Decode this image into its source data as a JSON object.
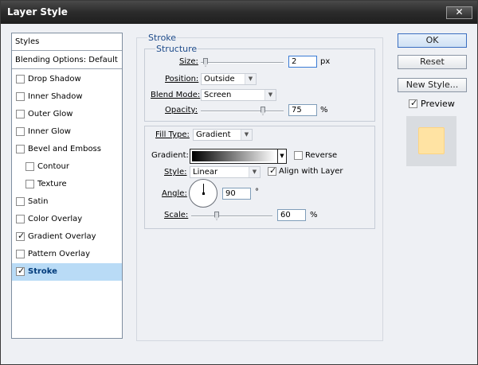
{
  "window": {
    "title": "Layer Style",
    "close_glyph": "✕"
  },
  "styles_list": {
    "header": "Styles",
    "blending": "Blending Options: Default",
    "items": [
      {
        "label": "Drop Shadow",
        "checked": false
      },
      {
        "label": "Inner Shadow",
        "checked": false
      },
      {
        "label": "Outer Glow",
        "checked": false
      },
      {
        "label": "Inner Glow",
        "checked": false
      },
      {
        "label": "Bevel and Emboss",
        "checked": false
      },
      {
        "label": "Contour",
        "checked": false
      },
      {
        "label": "Texture",
        "checked": false
      },
      {
        "label": "Satin",
        "checked": false
      },
      {
        "label": "Color Overlay",
        "checked": false
      },
      {
        "label": "Gradient Overlay",
        "checked": true
      },
      {
        "label": "Pattern Overlay",
        "checked": false
      },
      {
        "label": "Stroke",
        "checked": true,
        "selected": true
      }
    ]
  },
  "stroke": {
    "legend": "Stroke",
    "structure": {
      "legend": "Structure",
      "size_label": "Size:",
      "size_value": "2",
      "size_unit": "px",
      "position_label": "Position:",
      "position_value": "Outside",
      "blend_label": "Blend Mode:",
      "blend_value": "Screen",
      "opacity_label": "Opacity:",
      "opacity_value": "75",
      "opacity_unit": "%"
    },
    "fill": {
      "fill_type_label": "Fill Type:",
      "fill_type_value": "Gradient",
      "gradient_label": "Gradient:",
      "reverse_label": "Reverse",
      "reverse_checked": false,
      "style_label": "Style:",
      "style_value": "Linear",
      "align_label": "Align with Layer",
      "align_checked": true,
      "angle_label": "Angle:",
      "angle_value": "90",
      "angle_unit": "°",
      "scale_label": "Scale:",
      "scale_value": "60",
      "scale_unit": "%"
    }
  },
  "buttons": {
    "ok": "OK",
    "reset": "Reset",
    "new_style": "New Style...",
    "preview": "Preview",
    "preview_checked": true
  },
  "colors": {
    "accent": "#1e4b8a",
    "selected_row": "#b9dbf6",
    "preview_fill": "#ffe3a3"
  }
}
